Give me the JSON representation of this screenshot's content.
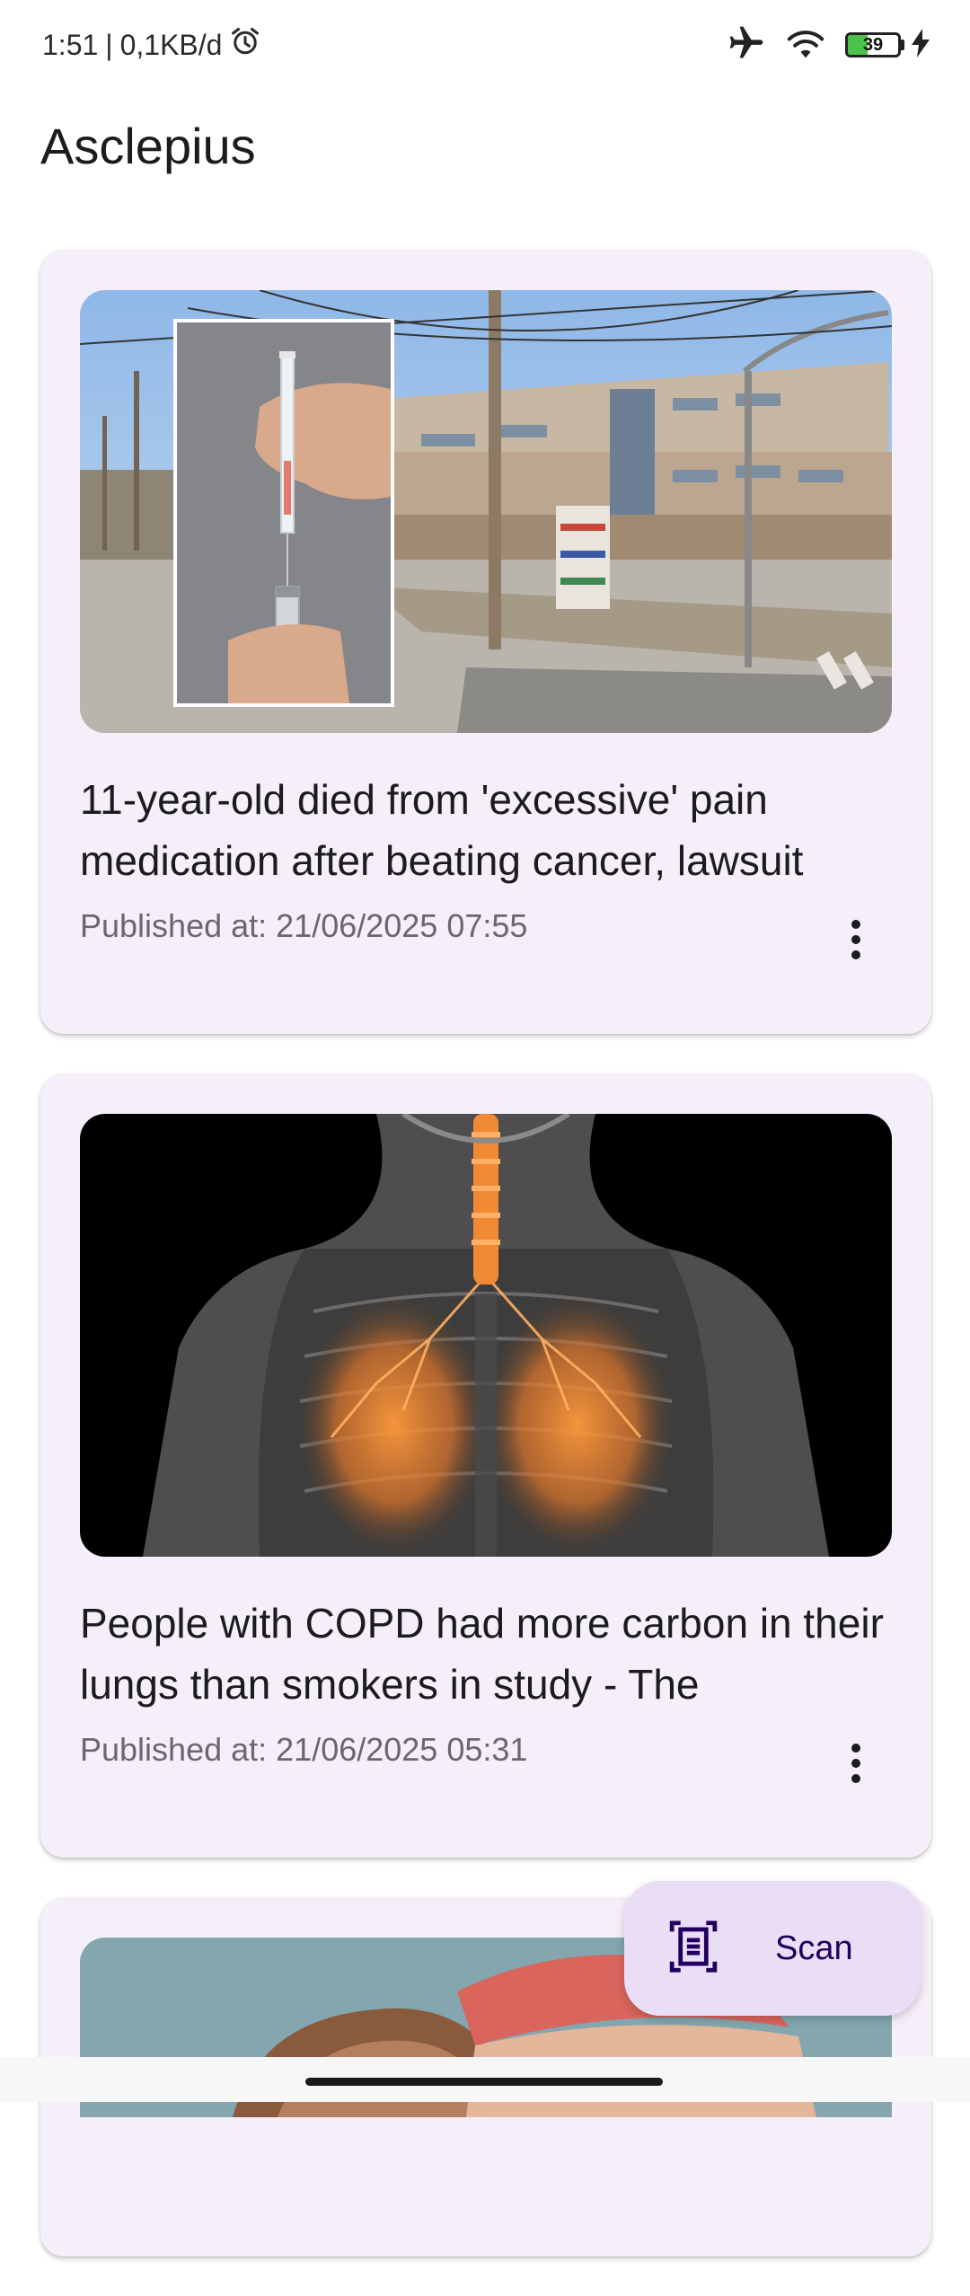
{
  "status_bar": {
    "time": "1:51",
    "separator": "|",
    "net_speed": "0,1KB/d",
    "battery_level": "39",
    "battery_fraction": 0.39,
    "icons": [
      "alarm-icon",
      "airplane-icon",
      "wifi-icon",
      "battery-icon",
      "charging-icon"
    ]
  },
  "app": {
    "title": "Asclepius"
  },
  "articles": [
    {
      "title": "11-year-old died from 'excessive' pain medication after beating cancer, lawsuit",
      "published": "Published at: 21/06/2025 07:55",
      "image": "syringe-and-hospital-photo"
    },
    {
      "title": "People with COPD had more carbon in their lungs than smokers in study - The",
      "published": "Published at: 21/06/2025 05:31",
      "image": "lungs-xray-illustration"
    },
    {
      "title": "",
      "published": "",
      "image": "person-portrait-photo"
    }
  ],
  "fab": {
    "label": "Scan",
    "icon": "document-scanner-icon"
  },
  "colors": {
    "card_bg": "#f4eff8",
    "fab_bg": "#eaddf6",
    "fab_text": "#21005d",
    "text_primary": "#1c1b1f",
    "text_secondary": "#6b6770"
  }
}
